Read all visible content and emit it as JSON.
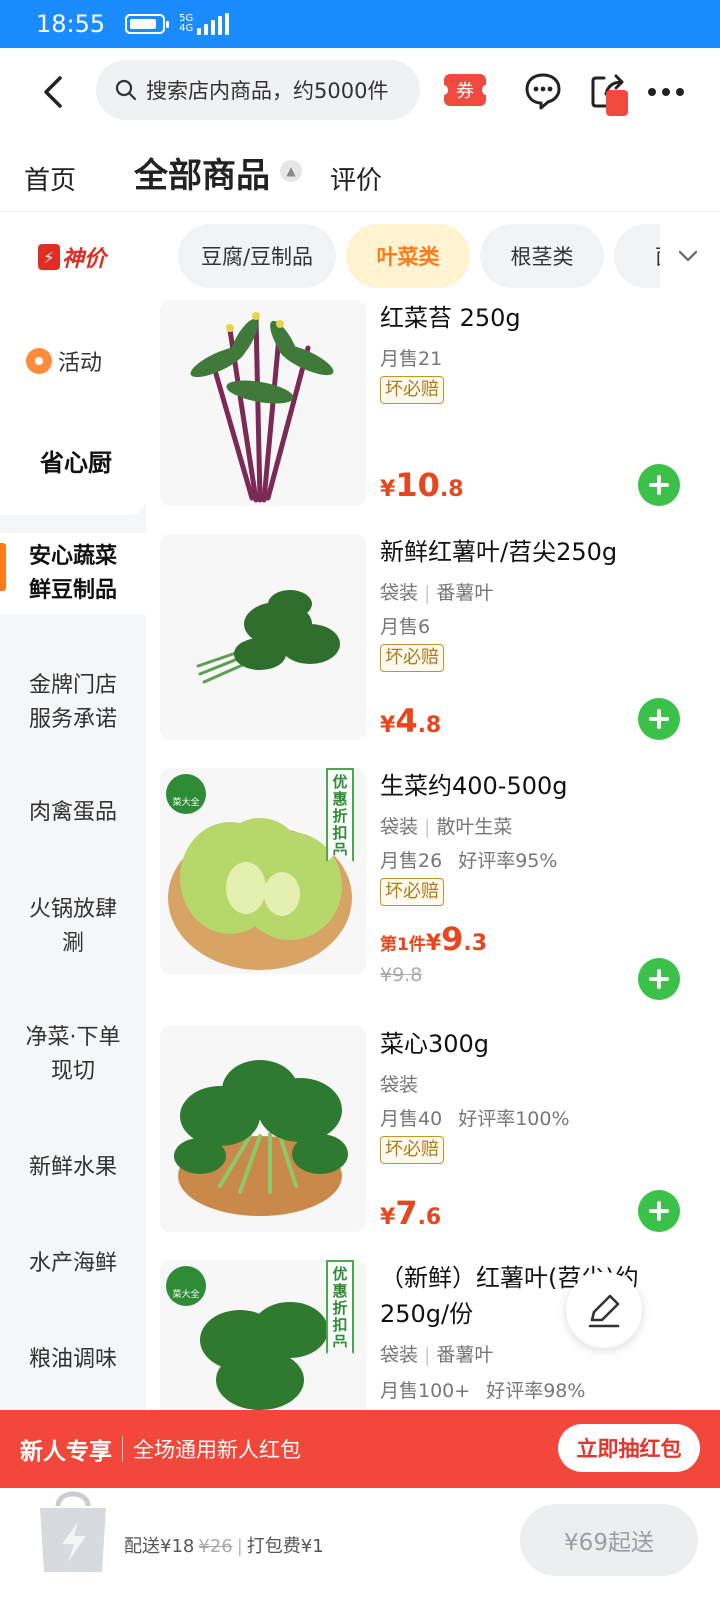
{
  "status": {
    "time": "18:55",
    "network_top": "5G",
    "network_bottom": "4G"
  },
  "topnav": {
    "search_placeholder": "搜索店内商品，约5000件",
    "coupon_label": "券"
  },
  "tabs": {
    "home": "首页",
    "all": "全部商品",
    "all_caret": "▲",
    "reviews": "评价"
  },
  "sidebar": {
    "deal": "神价",
    "activity": "活动",
    "chef": "省心厨",
    "items": [
      {
        "label": "安心蔬菜鲜豆制品"
      },
      {
        "label": "金牌门店服务承诺"
      },
      {
        "label": "肉禽蛋品"
      },
      {
        "label": "火锅放肆涮"
      },
      {
        "label": "净菜·下单现切"
      },
      {
        "label": "新鲜水果"
      },
      {
        "label": "水产海鲜"
      },
      {
        "label": "粮油调味"
      }
    ]
  },
  "chips": [
    "豆腐/豆制品",
    "叶菜类",
    "根茎类",
    "菌菇"
  ],
  "products": [
    {
      "name": "红菜苔 250g",
      "spec": "",
      "spec2": "",
      "sales": "月售21",
      "rate": "",
      "badge": "坏必赔",
      "prefix": "",
      "currency": "¥",
      "price_int": "10",
      "price_dec": ".8",
      "orig": ""
    },
    {
      "name": "新鲜红薯叶/苕尖250g",
      "spec": "袋装",
      "spec2": "番薯叶",
      "sales": "月售6",
      "rate": "",
      "badge": "坏必赔",
      "prefix": "",
      "currency": "¥",
      "price_int": "4",
      "price_dec": ".8",
      "orig": ""
    },
    {
      "name": "生菜约400-500g",
      "spec": "袋装",
      "spec2": "散叶生菜",
      "sales": "月售26",
      "rate": "好评率95%",
      "badge": "坏必赔",
      "prefix": "第1件",
      "currency": "¥",
      "price_int": "9",
      "price_dec": ".3",
      "orig": "¥9.8",
      "tag": "优惠折扣品",
      "logo": "菜大全"
    },
    {
      "name": "菜心300g",
      "spec": "袋装",
      "spec2": "",
      "sales": "月售40",
      "rate": "好评率100%",
      "badge": "坏必赔",
      "prefix": "",
      "currency": "¥",
      "price_int": "7",
      "price_dec": ".6",
      "orig": ""
    },
    {
      "name": "（新鲜）红薯叶(苕尖)约250g/份",
      "spec": "袋装",
      "spec2": "番薯叶",
      "sales": "月售100+",
      "rate": "好评率98%",
      "badge": "",
      "tag": "优惠折扣品",
      "logo": "菜大全"
    }
  ],
  "banner": {
    "title": "新人专享",
    "desc": "全场通用新人红包",
    "button": "立即抽红包"
  },
  "bottom": {
    "delivery": "配送¥18",
    "delivery_orig": "¥26",
    "sep": "|",
    "packing": "打包费¥1",
    "min_order": "¥69起送"
  },
  "colors": {
    "status_bar": "#1a8cff",
    "price": "#e8461e",
    "add": "#3bc14a",
    "banner": "#f2473a",
    "chip_active": "#ff7a1a"
  }
}
